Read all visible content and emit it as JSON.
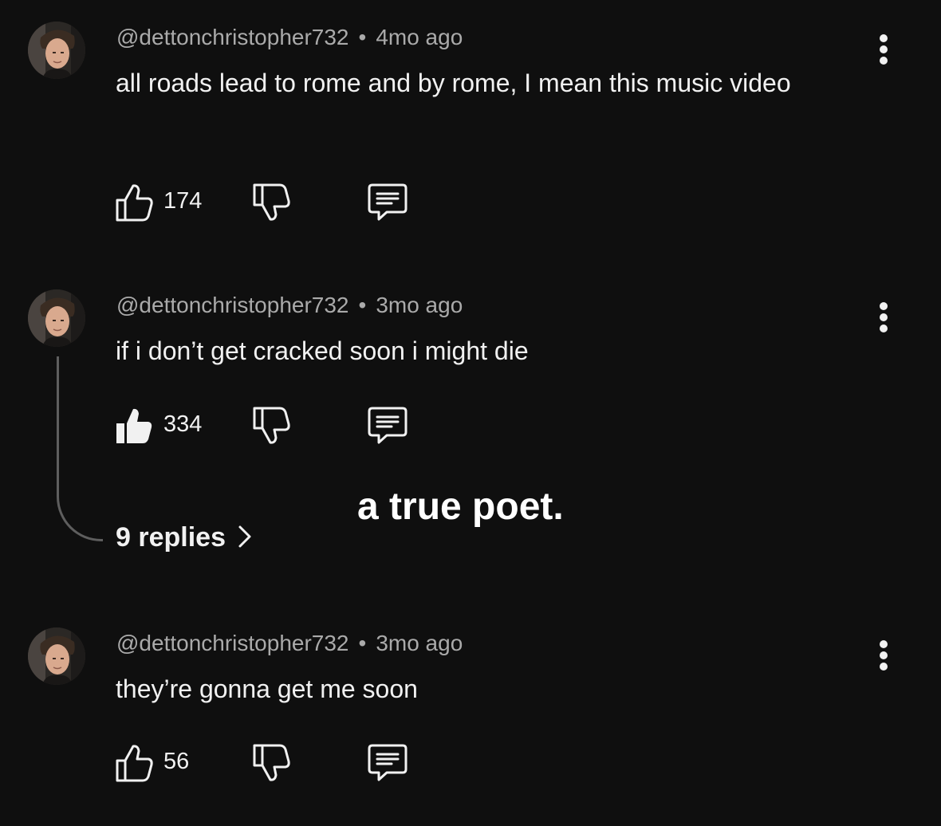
{
  "comments": [
    {
      "author": "@dettonchristopher732",
      "time": "4mo ago",
      "text": "all roads lead to rome and by rome, I mean this music video",
      "likes": "174",
      "liked": false
    },
    {
      "author": "@dettonchristopher732",
      "time": "3mo ago",
      "text": "if i don’t get cracked soon i might die",
      "likes": "334",
      "liked": true,
      "replies_label": "9 replies"
    },
    {
      "author": "@dettonchristopher732",
      "time": "3mo ago",
      "text": "they’re gonna get me soon",
      "likes": "56",
      "liked": false
    }
  ],
  "separator": "•",
  "caption": "a true poet.",
  "icons": {
    "like": "thumbs-up-icon",
    "dislike": "thumbs-down-icon",
    "reply": "comment-icon",
    "menu": "more-vertical-icon",
    "replies_arrow": "chevron-right-icon"
  },
  "colors": {
    "background": "#0f0f0f",
    "text": "#f1f1f1",
    "meta": "#aaaaaa",
    "thread_line": "#5e5e5e"
  }
}
